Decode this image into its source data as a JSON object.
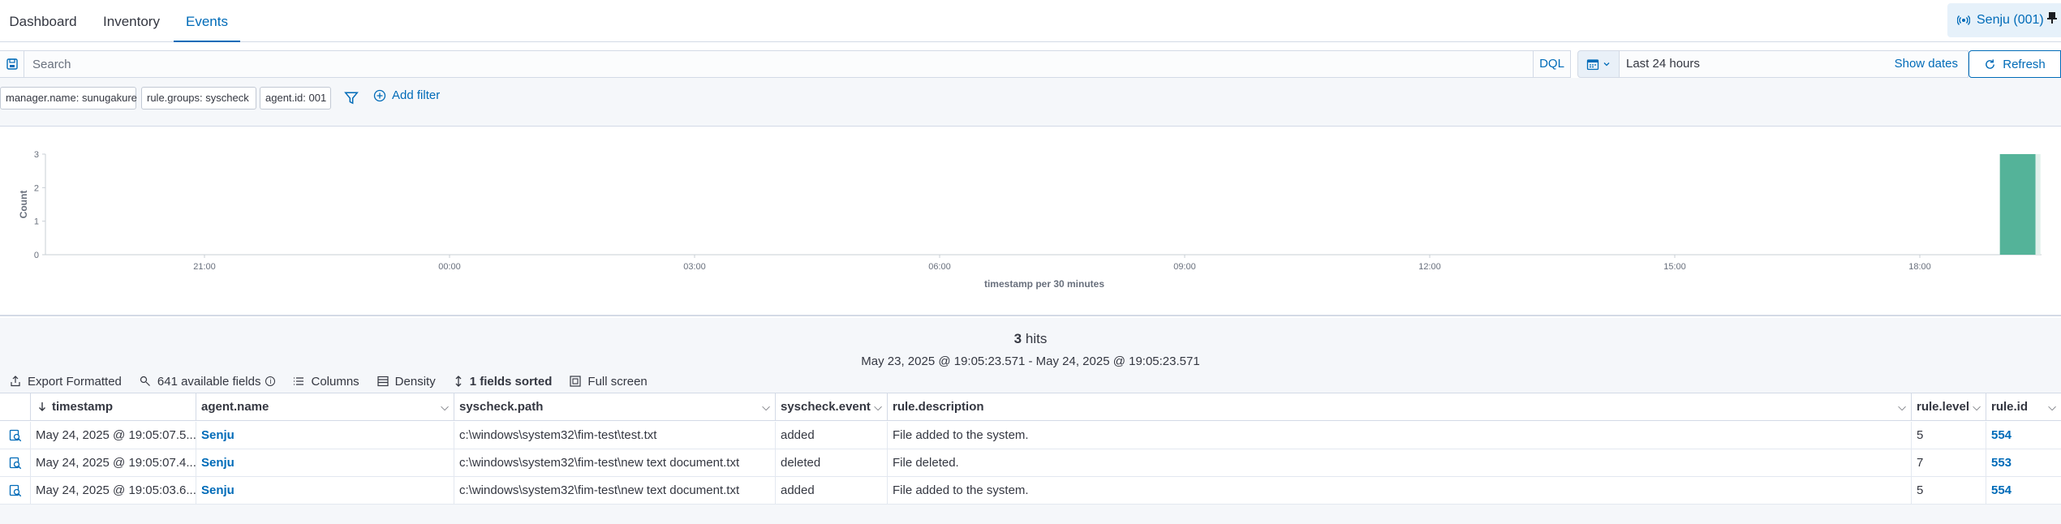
{
  "tabs": [
    {
      "label": "Dashboard",
      "active": false
    },
    {
      "label": "Inventory",
      "active": false
    },
    {
      "label": "Events",
      "active": true
    }
  ],
  "agent_chip": {
    "label": "Senju (001)",
    "icon": "antenna-icon"
  },
  "search": {
    "placeholder": "Search",
    "language": "DQL"
  },
  "date_picker": {
    "range": "Last 24 hours",
    "show_dates_label": "Show dates",
    "refresh_label": "Refresh"
  },
  "filters": [
    {
      "label": "manager.name: sunugakure"
    },
    {
      "label": "rule.groups: syscheck"
    },
    {
      "label": "agent.id: 001"
    }
  ],
  "add_filter_label": "Add filter",
  "chart_data": {
    "type": "bar",
    "title": "",
    "xlabel": "timestamp per 30 minutes",
    "ylabel": "Count",
    "ylim": [
      0,
      3
    ],
    "yticks": [
      "0",
      "1",
      "2",
      "3"
    ],
    "xticks": [
      "21:00",
      "00:00",
      "03:00",
      "06:00",
      "09:00",
      "12:00",
      "15:00",
      "18:00"
    ],
    "series": [
      {
        "x": "19:00",
        "values": [
          3
        ]
      }
    ],
    "bar_color": "#54b399"
  },
  "results": {
    "hits_count": "3",
    "hits_label": "hits",
    "range": "May 23, 2025 @ 19:05:23.571 - May 24, 2025 @ 19:05:23.571"
  },
  "toolbar": {
    "export": "Export Formatted",
    "fields": "641 available fields",
    "columns": "Columns",
    "density": "Density",
    "sorted": "1 fields sorted",
    "fullscreen": "Full screen"
  },
  "table": {
    "columns": [
      "timestamp",
      "agent.name",
      "syscheck.path",
      "syscheck.event",
      "rule.description",
      "rule.level",
      "rule.id"
    ],
    "rows": [
      [
        "May 24, 2025 @ 19:05:07.5...",
        "Senju",
        "c:\\windows\\system32\\fim-test\\test.txt",
        "added",
        "File added to the system.",
        "5",
        "554"
      ],
      [
        "May 24, 2025 @ 19:05:07.4...",
        "Senju",
        "c:\\windows\\system32\\fim-test\\new text document.txt",
        "deleted",
        "File deleted.",
        "7",
        "553"
      ],
      [
        "May 24, 2025 @ 19:05:03.6...",
        "Senju",
        "c:\\windows\\system32\\fim-test\\new text document.txt",
        "added",
        "File added to the system.",
        "5",
        "554"
      ]
    ]
  },
  "colors": {
    "accent": "#006bb8",
    "bar": "#54b399",
    "text": "#343741"
  }
}
